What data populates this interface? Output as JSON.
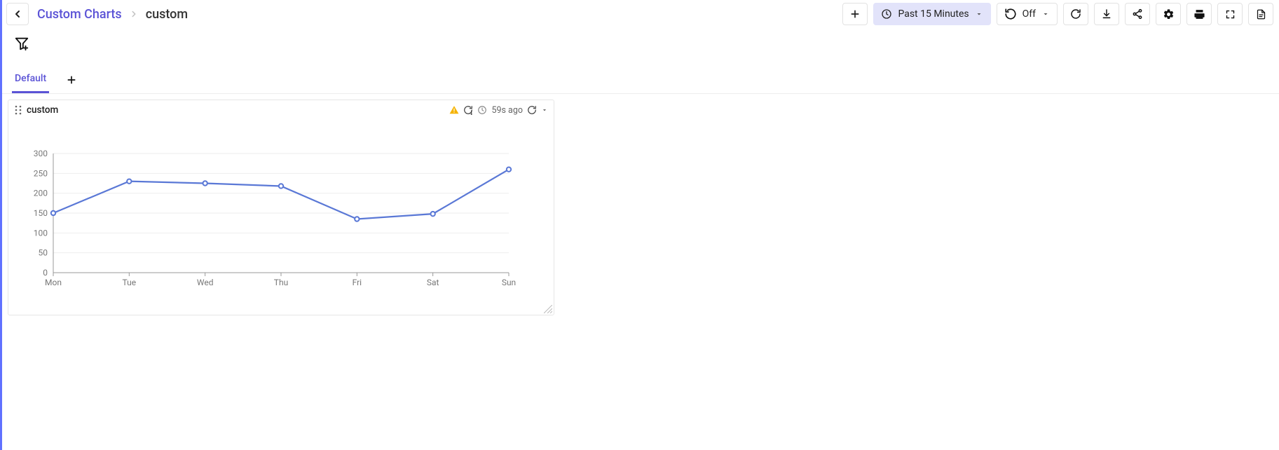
{
  "breadcrumb": {
    "root": "Custom Charts",
    "current": "custom"
  },
  "toolbar": {
    "time_range": "Past 15 Minutes",
    "auto_refresh": "Off"
  },
  "tabs": {
    "active": "Default"
  },
  "panel": {
    "title": "custom",
    "time_ago": "59s ago"
  },
  "chart_data": {
    "type": "line",
    "categories": [
      "Mon",
      "Tue",
      "Wed",
      "Thu",
      "Fri",
      "Sat",
      "Sun"
    ],
    "values": [
      150,
      230,
      225,
      218,
      135,
      148,
      260
    ],
    "ylim": [
      0,
      300
    ],
    "yticks": [
      0,
      50,
      100,
      150,
      200,
      250,
      300
    ],
    "title": "",
    "xlabel": "",
    "ylabel": ""
  }
}
